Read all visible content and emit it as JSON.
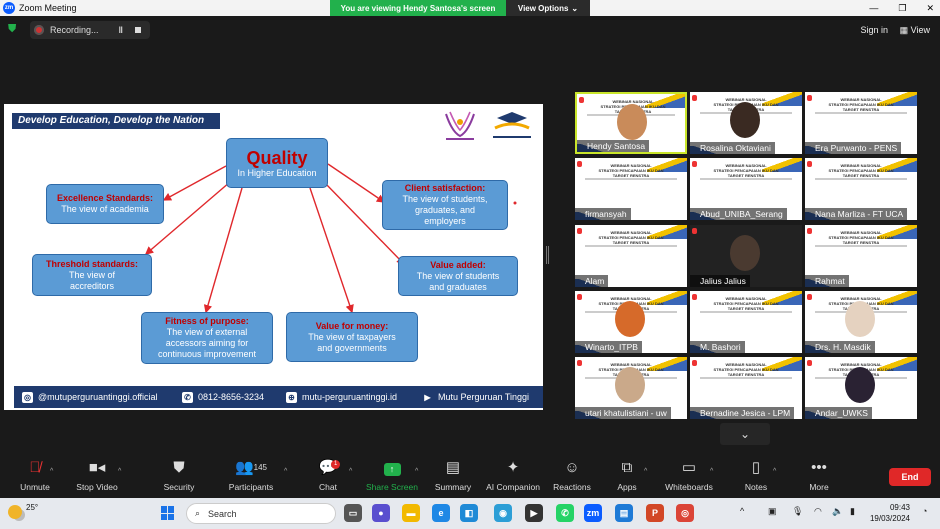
{
  "window": {
    "title": "Zoom Meeting",
    "app_icon": "zm"
  },
  "banner": {
    "message": "You are viewing Hendy Santosa's screen",
    "view_options": "View Options"
  },
  "topbar": {
    "recording": "Recording...",
    "sign_in": "Sign in",
    "view": "View"
  },
  "slide": {
    "header": "Develop Education, Develop the Nation",
    "quality": {
      "title": "Quality",
      "sub": "In Higher Education"
    },
    "excellence": {
      "title": "Excellence Standards:",
      "body": "The view of academia"
    },
    "threshold": {
      "title": "Threshold standards:",
      "body_1": "The view of",
      "body_2": "accreditors"
    },
    "fitness": {
      "title": "Fitness of purpose:",
      "body_1": "The view of external",
      "body_2": "accessors aiming for",
      "body_3": "continuous improvement"
    },
    "money": {
      "title": "Value for money:",
      "body_1": "The view of taxpayers",
      "body_2": "and governments"
    },
    "client": {
      "title": "Client satisfaction:",
      "body_1": "The view of students,",
      "body_2": "graduates, and",
      "body_3": "employers"
    },
    "added": {
      "title": "Value added:",
      "body_1": "The view of students",
      "body_2": "and graduates"
    },
    "footer": {
      "instagram": "@mutuperguruantinggi.official",
      "phone": "0812-8656-3234",
      "web": "mutu-perguruantinggi.id",
      "youtube": "Mutu Perguruan Tinggi"
    }
  },
  "tile_text": {
    "l1": "WEBINAR NASIONAL",
    "l2": "STRATEGI PENCAPAIAN IKU DAN TARGET RENSTRA"
  },
  "participants": [
    {
      "name": "Hendy Santosa"
    },
    {
      "name": "Rosalina Oktaviani"
    },
    {
      "name": "Era Purwanto - PENS"
    },
    {
      "name": "firmansyah"
    },
    {
      "name": "Abud_UNIBA_Serang"
    },
    {
      "name": "Nana Marliza - FT UCA"
    },
    {
      "name": "Alam"
    },
    {
      "name": "Jalius Jalius"
    },
    {
      "name": "Rahmat"
    },
    {
      "name": "Winarto_ITPB"
    },
    {
      "name": "M. Bashori"
    },
    {
      "name": "Drs. H. Masdik"
    },
    {
      "name": "utari khatulistiani - uw"
    },
    {
      "name": "Bernadine Jesica - LPM"
    },
    {
      "name": "Andar_UWKS"
    }
  ],
  "toolbar": {
    "unmute": "Unmute",
    "stop_video": "Stop Video",
    "security": "Security",
    "participants": "Participants",
    "participants_count": "145",
    "chat": "Chat",
    "chat_badge": "1",
    "share_screen": "Share Screen",
    "summary": "Summary",
    "ai_companion": "AI Companion",
    "reactions": "Reactions",
    "apps": "Apps",
    "whiteboards": "Whiteboards",
    "notes": "Notes",
    "more": "More",
    "end": "End"
  },
  "taskbar": {
    "temp": "25°",
    "search": "Search",
    "time": "09:43",
    "date": "19/03/2024"
  },
  "colors": {
    "share_green": "#22b14c",
    "end_red": "#e02828",
    "slide_navy": "#1f3a6e",
    "box_blue": "#5b9bd5",
    "active_border": "#c9e52b"
  }
}
